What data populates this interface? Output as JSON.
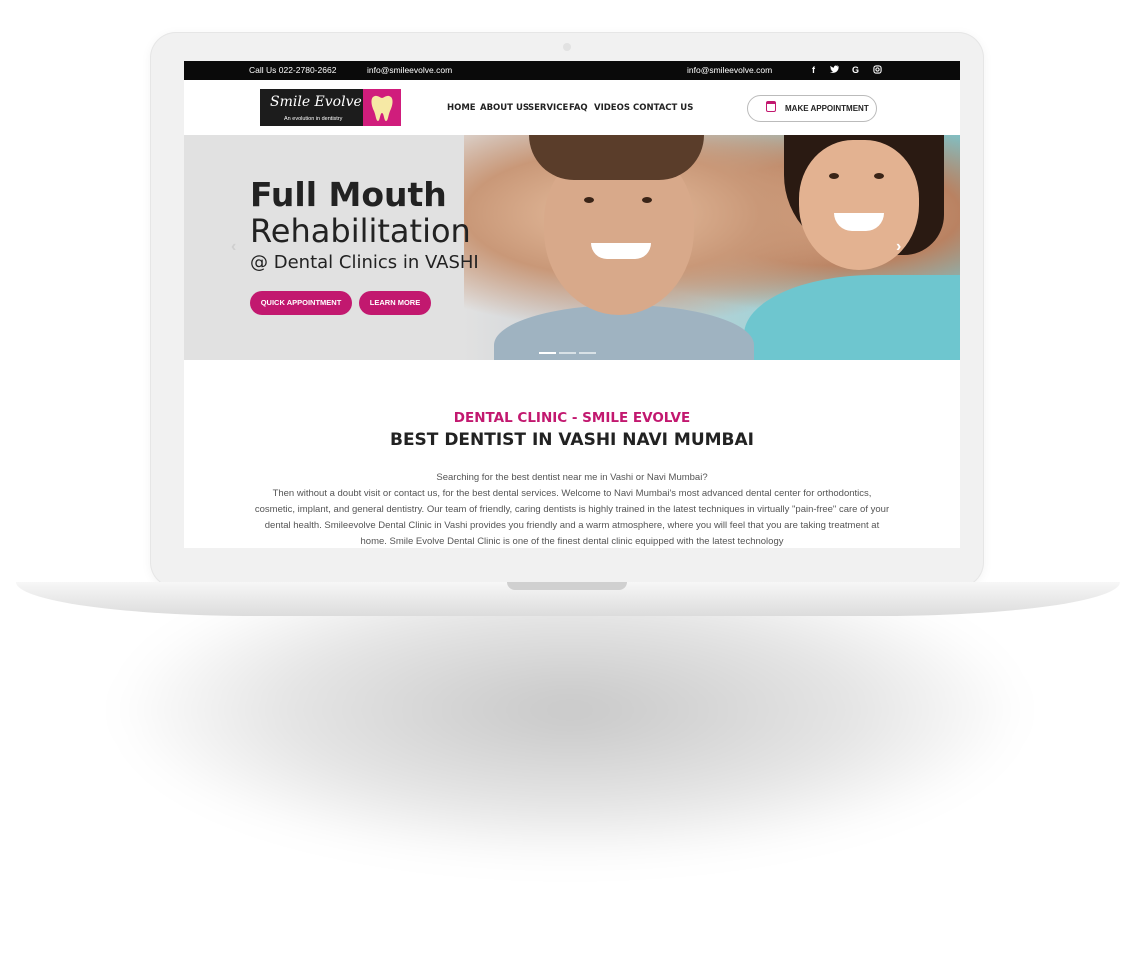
{
  "topbar": {
    "phone": "Call Us 022-2780-2662",
    "email_left": "info@smileevolve.com",
    "email_right": "info@smileevolve.com",
    "social": [
      "f",
      "t",
      "G",
      "o"
    ]
  },
  "logo": {
    "name": "Smile Evolve",
    "tagline": "An evolution in dentistry"
  },
  "nav": {
    "items": [
      "HOME",
      "ABOUT US",
      "SERVICE",
      "FAQ",
      "VIDEOS",
      "CONTACT US"
    ],
    "appointment_label": "MAKE APPOINTMENT"
  },
  "hero": {
    "line1": "Full Mouth",
    "line2": "Rehabilitation",
    "line3": "@ Dental Clinics in VASHI",
    "btn_quick": "QUICK APPOINTMENT",
    "btn_learn": "LEARN MORE",
    "prev": "‹",
    "next": "›"
  },
  "section": {
    "subtitle": "DENTAL CLINIC - SMILE EVOLVE",
    "title": "BEST DENTIST IN VASHI NAVI MUMBAI",
    "para1": "Searching for the best dentist near me in Vashi or Navi Mumbai?",
    "para2": "Then without a doubt visit or contact us, for the best dental services. Welcome to Navi Mumbai's most advanced dental center for orthodontics, cosmetic, implant, and general dentistry. Our team of friendly, caring dentists is highly trained in the latest techniques in virtually \"pain-free\" care of your dental health. Smileevolve Dental Clinic in Vashi provides you friendly and a warm atmosphere, where you will feel that you are taking treatment at home. Smile Evolve Dental Clinic is one of the finest dental clinic equipped with the latest technology"
  },
  "colors": {
    "accent": "#c2186f",
    "topbar": "#0a0a0a"
  }
}
